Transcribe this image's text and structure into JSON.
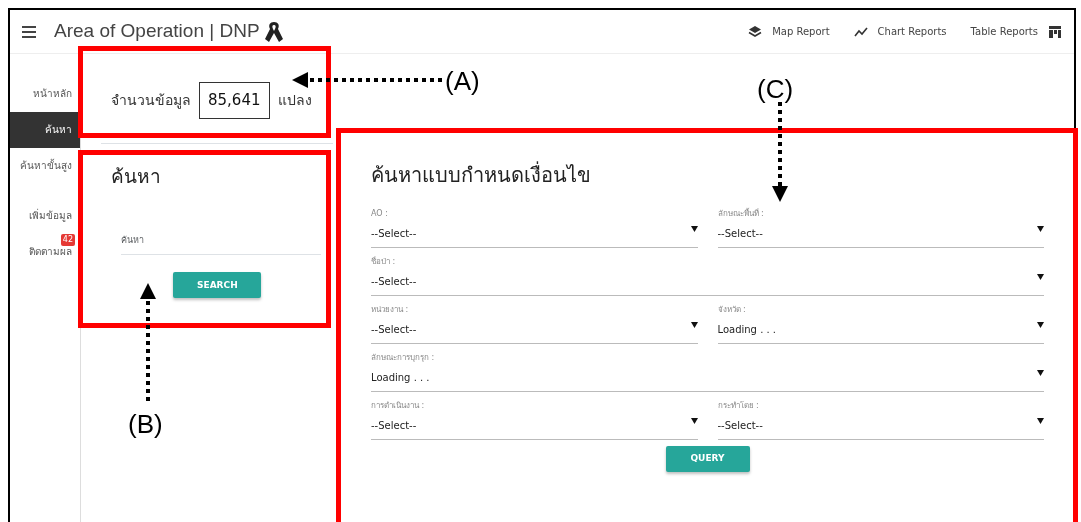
{
  "header": {
    "title": "Area of Operation | DNP",
    "nav": [
      {
        "label": "Map Report"
      },
      {
        "label": "Chart Reports"
      },
      {
        "label": "Table Reports"
      }
    ]
  },
  "sidebar": {
    "items": [
      {
        "label": "หน้าหลัก",
        "selected": false
      },
      {
        "label": "ค้นหา",
        "selected": true
      },
      {
        "label": "ค้นหาขั้นสูง",
        "selected": false
      },
      {
        "label": "เพิ่มข้อมูล",
        "selected": false
      },
      {
        "label": "ติดตามผล",
        "selected": false,
        "badge": "42"
      }
    ]
  },
  "count_panel": {
    "label": "จำนวนข้อมูล",
    "value": "85,641",
    "unit": "แปลง"
  },
  "search_panel": {
    "title": "ค้นหา",
    "placeholder": "ค้นหา",
    "button": "SEARCH"
  },
  "query_panel": {
    "title": "ค้นหาแบบกำหนดเงื่อนไข",
    "fields": [
      {
        "label": "AO :",
        "value": "--Select--",
        "kind": "half"
      },
      {
        "label": "ลักษณะพื้นที่ :",
        "value": "--Select--",
        "kind": "half"
      },
      {
        "label": "ชื่อป่า :",
        "value": "--Select--",
        "kind": "full"
      },
      {
        "label": "หน่วยงาน :",
        "value": "--Select--",
        "kind": "half"
      },
      {
        "label": "จังหวัด :",
        "value": "Loading . . .",
        "kind": "half"
      },
      {
        "label": "ลักษณะการบุกรุก :",
        "value": "Loading . . .",
        "kind": "full"
      },
      {
        "label": "การดำเนินงาน :",
        "value": "--Select--",
        "kind": "half"
      },
      {
        "label": "กระทำโดย :",
        "value": "--Select--",
        "kind": "half"
      }
    ],
    "button": "QUERY"
  },
  "annotations": [
    {
      "label": "(A)",
      "kind": "left"
    },
    {
      "label": "(B)",
      "kind": "up"
    },
    {
      "label": "(C)",
      "kind": "down"
    }
  ]
}
